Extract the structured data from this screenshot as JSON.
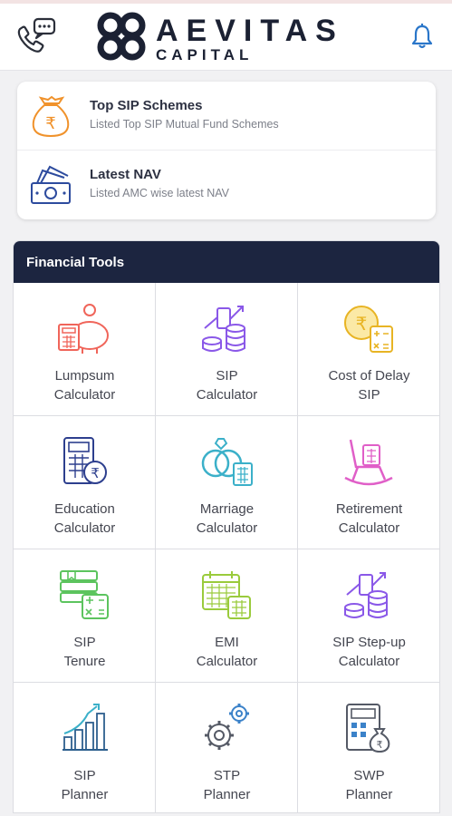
{
  "header": {
    "brand_name": "AEVITAS",
    "brand_sub": "CAPITAL",
    "call_icon": "phone-chat-icon",
    "notify_icon": "bell-icon"
  },
  "quick_links": [
    {
      "title": "Top SIP Schemes",
      "subtitle": "Listed Top SIP Mutual Fund Schemes",
      "icon": "money-bag-rupee-icon"
    },
    {
      "title": "Latest NAV",
      "subtitle": "Listed AMC wise latest NAV",
      "icon": "cash-stack-icon"
    }
  ],
  "tools": {
    "title": "Financial Tools",
    "items": [
      {
        "line1": "Lumpsum",
        "line2": "Calculator",
        "icon": "piggy-bank-calculator-icon",
        "color": "#f0655a"
      },
      {
        "line1": "SIP",
        "line2": "Calculator",
        "icon": "coins-chart-icon",
        "color": "#8a58e8"
      },
      {
        "line1": "Cost of Delay",
        "line2": "SIP",
        "icon": "rupee-coin-calculator-icon",
        "color": "#f2c12e"
      },
      {
        "line1": "Education",
        "line2": "Calculator",
        "icon": "calculator-rupee-icon",
        "color": "#2d3f8e"
      },
      {
        "line1": "Marriage",
        "line2": "Calculator",
        "icon": "rings-calculator-icon",
        "color": "#3bb0c9"
      },
      {
        "line1": "Retirement",
        "line2": "Calculator",
        "icon": "rocking-chair-icon",
        "color": "#e05fc8"
      },
      {
        "line1": "SIP",
        "line2": "Tenure",
        "icon": "calendar-calculator-icon",
        "color": "#5cc45e"
      },
      {
        "line1": "EMI",
        "line2": "Calculator",
        "icon": "calendar-grid-icon",
        "color": "#9acb3c"
      },
      {
        "line1": "SIP Step-up",
        "line2": "Calculator",
        "icon": "coins-growth-icon",
        "color": "#8a58e8"
      },
      {
        "line1": "SIP",
        "line2": "Planner",
        "icon": "bar-growth-icon",
        "color": "#2d5f8e"
      },
      {
        "line1": "STP",
        "line2": "Planner",
        "icon": "gears-icon",
        "color": "#555a66"
      },
      {
        "line1": "SWP",
        "line2": "Planner",
        "icon": "calculator-bag-icon",
        "color": "#555a66"
      }
    ]
  }
}
